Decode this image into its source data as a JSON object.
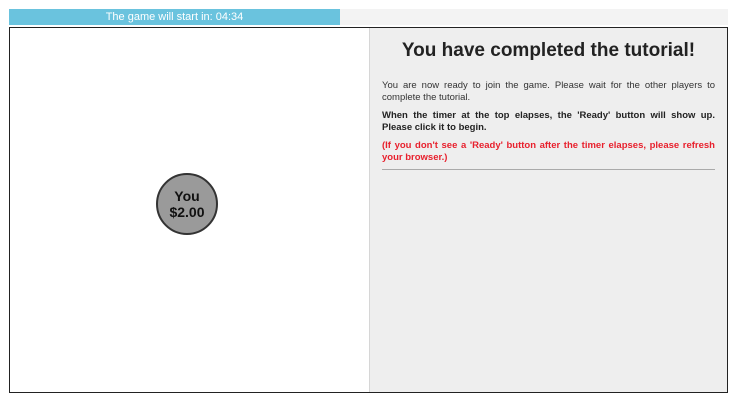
{
  "timer": {
    "label": "The game will start in: 04:34"
  },
  "player": {
    "name": "You",
    "amount": "$2.00"
  },
  "panel": {
    "title": "You have completed the tutorial!",
    "paragraph1": "You are now ready to join the game. Please wait for the other players to complete the tutorial.",
    "paragraph2": "When the timer at the top elapses, the 'Ready' button will show up. Please click it to begin.",
    "paragraph3": "(If you don't see a 'Ready' button after the timer elapses, please refresh your browser.)"
  },
  "colors": {
    "timer_bar": "#6ac3de",
    "node_fill": "#9a9a9a",
    "warning_text": "#e8202d",
    "panel_bg": "#eeeeee"
  }
}
